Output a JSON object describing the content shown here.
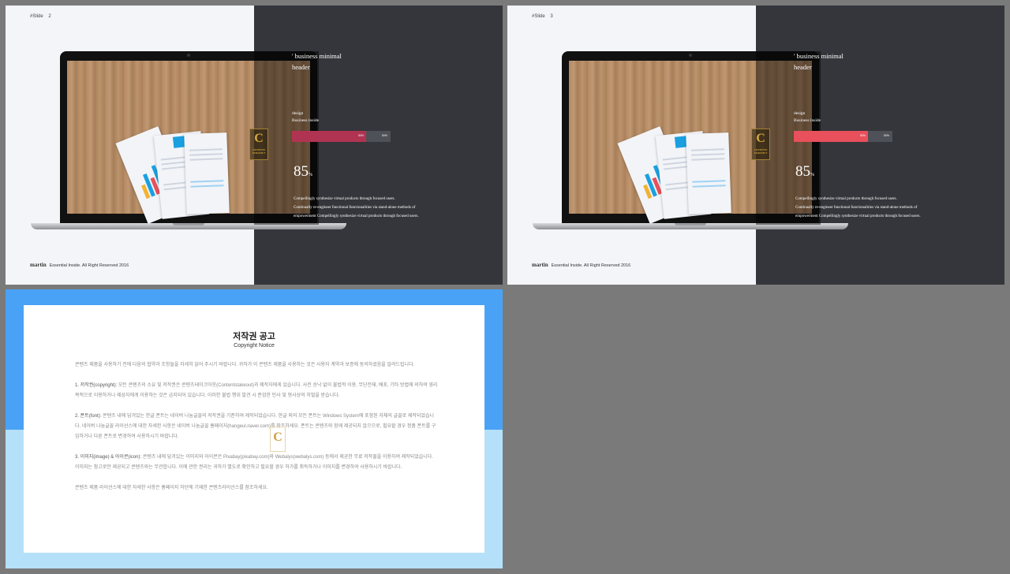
{
  "slides": [
    {
      "number_label": "#Slide",
      "number": "2",
      "heading_line1": "' business minimal",
      "heading_line2": "header",
      "sub1": "design",
      "sub2": "Business inside",
      "bar_value_label": "50%",
      "bar_rest_label": "50%",
      "bar_fill_fraction": 0.75,
      "bar_color": "#b03452",
      "big_number": "85",
      "big_unit": "%",
      "desc1": "Compellingly synthesize virtual products through focused users.",
      "desc2": "Continually re-engineer functional functionalities via stand-alone methods of",
      "desc3": "empowerment Compellingly synthesize virtual products through focused users.",
      "footer_brand": "martin",
      "footer_text": "Essential Inside. All Right Reserved 2016"
    },
    {
      "number_label": "#Slide",
      "number": "3",
      "heading_line1": "' business minimal",
      "heading_line2": "header",
      "sub1": "design",
      "sub2": "Business inside",
      "bar_value_label": "50%",
      "bar_rest_label": "50%",
      "bar_fill_fraction": 0.75,
      "bar_color": "#e8505b",
      "big_number": "85",
      "big_unit": "%",
      "desc1": "Compellingly synthesize virtual products through focused users.",
      "desc2": "Continually re-engineer functional functionalities via stand-alone methods of",
      "desc3": "empowerment Compellingly synthesize virtual products through focused users.",
      "footer_brand": "martin",
      "footer_text": "Essential Inside. All Right Reserved 2016"
    }
  ],
  "watermark": {
    "letter": "C",
    "text1": "CONTENTS",
    "text2": "STAKEOUT"
  },
  "notice": {
    "title": "저작권 공고",
    "subtitle": "Copyright Notice",
    "intro": "콘텐츠 제품을 사용하기 전에 다음의 협약과 조항들을 자세히 읽어 주시기 바랍니다. 귀하가 이 콘텐츠 제품을 사용하는 것은 사용자 계약과 보증에 동의하셨음을 알려드립니다.",
    "p1_title": "1. 저작권(copyright):",
    "p1": " 모든 콘텐츠의 소유 및 저작권은 콘텐츠테이크아웃(Contentstakeout)과 제작자에게 있습니다. 사전 승낙 없이 불법적 이용, 무단전재, 배포, 기타 방법에 의하여 영리 목적으로 이용하거나 제삼자에게 이용하는 것은 금지되어 있습니다. 이러한 불법 행위 발견 시 준엄한 민사 및 형사상의 처벌을 받습니다.",
    "p2_title": "2. 폰트(font):",
    "p2": " 콘텐츠 내에 담겨있는 한글 폰트는 네이버 나눔글꼴의 저작권을 기준하여 제작되었습니다. 한글 외의 모든 폰트는 Windows System에 포함된 자체의 글꼴로 제작되었습니다. 네이버 나눔글꼴 라이선스에 대한 자세한 사항은 네이버 나눔글꼴 홈페이지(hangeul.naver.com)를 참조하세요. 폰트는 콘텐츠와 함께 제공되지 않으므로, 필요할 경우 정품 폰트를 구입하거나 다른 폰트로 변경하여 사용하시기 바랍니다.",
    "p3_title": "3. 이미지(image) & 아이콘(icon):",
    "p3": " 콘텐츠 내에 담겨있는 이미지와 아이콘은 Pixabay(pixabay.com)와 Webalys(webalys.com) 등에서 제공한 무료 저작물을 이용하여 제작되었습니다. 이미지는 참고로만 제공되고 콘텐츠와는 무관합니다. 이에 관한 권리는 귀하가 별도로 확인하고 필요할 경우 허가를 취득하거나 이미지를 변경하여 사용하시기 바랍니다.",
    "outro": "콘텐츠 제품 라이선스에 대한 자세한 사항은 홈페이지 하단에 기재한 콘텐츠라이선스를 참조하세요."
  }
}
